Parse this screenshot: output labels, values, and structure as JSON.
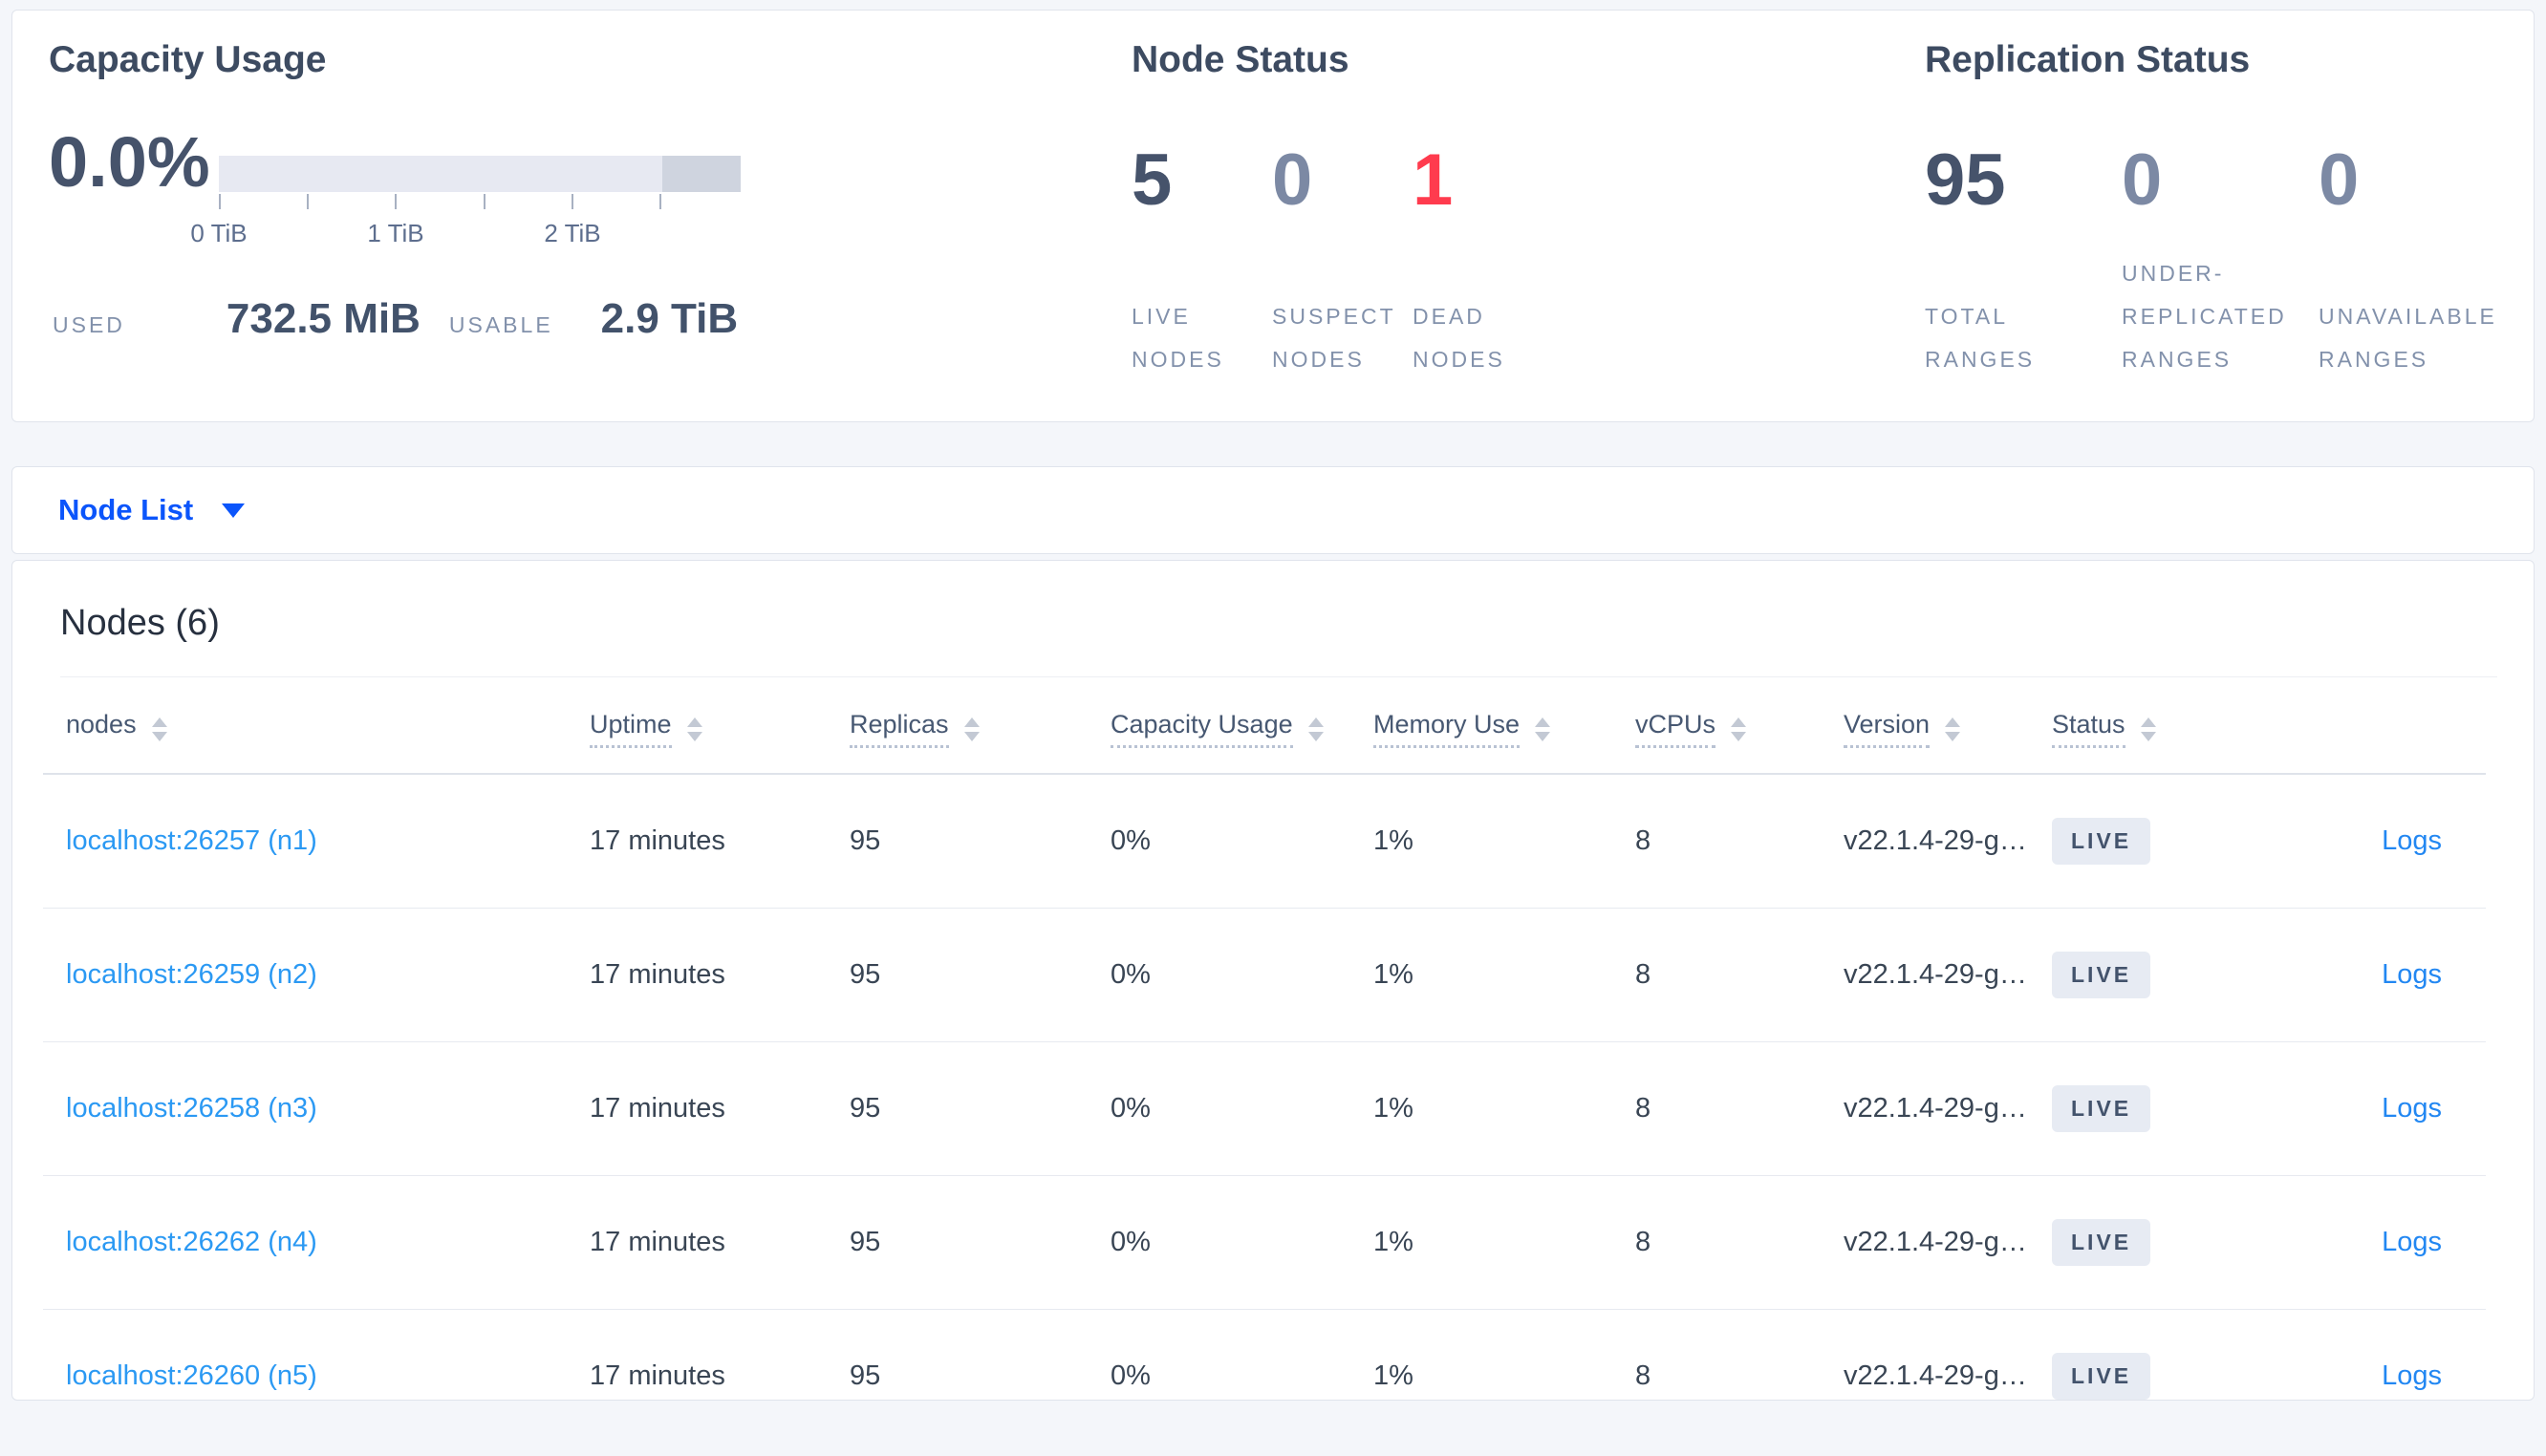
{
  "capacity_panel": {
    "title": "Capacity Usage",
    "percent": "0.0%",
    "tick_labels": [
      "0 TiB",
      "1 TiB",
      "2 TiB"
    ],
    "used_label": "USED",
    "used_value": "732.5 MiB",
    "usable_label": "USABLE",
    "usable_value": "2.9 TiB",
    "bar_colors": {
      "usable": "#e7e9f2",
      "other": "#cfd4df"
    }
  },
  "node_status_panel": {
    "title": "Node Status",
    "metrics": [
      {
        "value": "5",
        "label": "LIVE NODES",
        "color": "#46536b"
      },
      {
        "value": "0",
        "label": "SUSPECT NODES",
        "color": "#7c89a4"
      },
      {
        "value": "1",
        "label": "DEAD NODES",
        "color": "#ff3b4e"
      }
    ]
  },
  "replication_panel": {
    "title": "Replication Status",
    "metrics": [
      {
        "value": "95",
        "label": "TOTAL RANGES",
        "color": "#46536b"
      },
      {
        "value": "0",
        "label": "UNDER-REPLICATED RANGES",
        "color": "#7c89a4"
      },
      {
        "value": "0",
        "label": "UNAVAILABLE RANGES",
        "color": "#7c89a4"
      }
    ]
  },
  "view_selector": {
    "label": "Node List"
  },
  "nodes_table": {
    "title": "Nodes (6)",
    "columns": [
      {
        "label": "nodes",
        "underlined": false
      },
      {
        "label": "Uptime",
        "underlined": true
      },
      {
        "label": "Replicas",
        "underlined": true
      },
      {
        "label": "Capacity Usage",
        "underlined": true
      },
      {
        "label": "Memory Use",
        "underlined": true
      },
      {
        "label": "vCPUs",
        "underlined": true
      },
      {
        "label": "Version",
        "underlined": true
      },
      {
        "label": "Status",
        "underlined": true
      }
    ],
    "logs_label": "Logs",
    "rows": [
      {
        "address": "localhost:26257 (n1)",
        "uptime": "17 minutes",
        "replicas": "95",
        "capacity_usage": "0%",
        "memory_use": "1%",
        "vcpus": "8",
        "version": "v22.1.4-29-g…",
        "status": "LIVE"
      },
      {
        "address": "localhost:26259 (n2)",
        "uptime": "17 minutes",
        "replicas": "95",
        "capacity_usage": "0%",
        "memory_use": "1%",
        "vcpus": "8",
        "version": "v22.1.4-29-g…",
        "status": "LIVE"
      },
      {
        "address": "localhost:26258 (n3)",
        "uptime": "17 minutes",
        "replicas": "95",
        "capacity_usage": "0%",
        "memory_use": "1%",
        "vcpus": "8",
        "version": "v22.1.4-29-g…",
        "status": "LIVE"
      },
      {
        "address": "localhost:26262 (n4)",
        "uptime": "17 minutes",
        "replicas": "95",
        "capacity_usage": "0%",
        "memory_use": "1%",
        "vcpus": "8",
        "version": "v22.1.4-29-g…",
        "status": "LIVE"
      },
      {
        "address": "localhost:26260 (n5)",
        "uptime": "17 minutes",
        "replicas": "95",
        "capacity_usage": "0%",
        "memory_use": "1%",
        "vcpus": "8",
        "version": "v22.1.4-29-g…",
        "status": "LIVE"
      }
    ]
  }
}
